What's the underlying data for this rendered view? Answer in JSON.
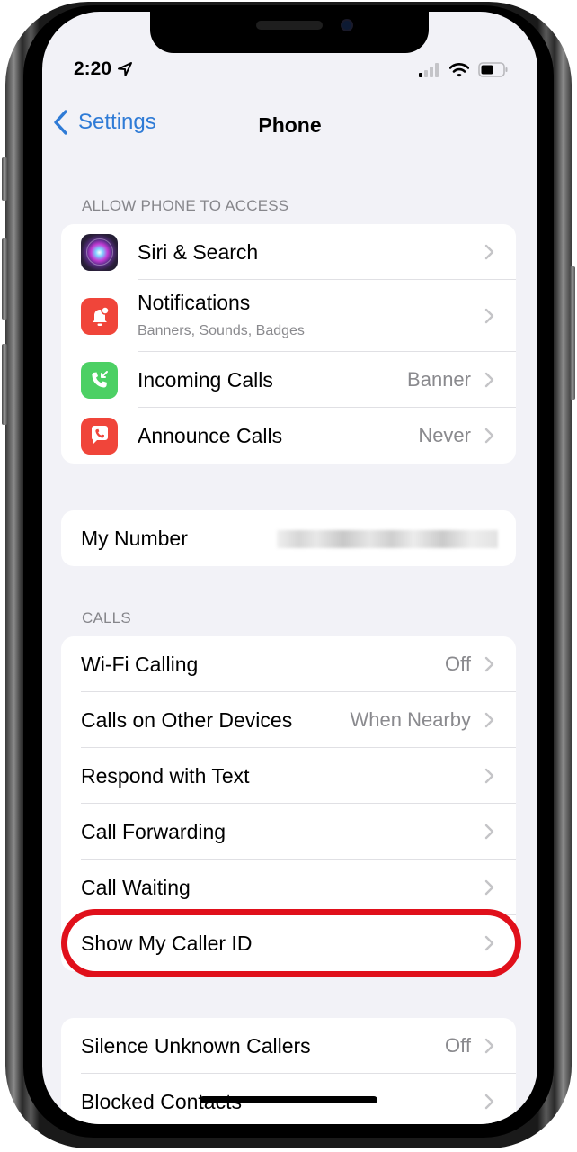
{
  "status_bar": {
    "time": "2:20",
    "location_icon": "location-arrow-icon",
    "signal_icon": "cellular-signal-icon",
    "wifi_icon": "wifi-icon",
    "battery_icon": "battery-icon"
  },
  "nav": {
    "back_label": "Settings",
    "title": "Phone"
  },
  "sections": {
    "access": {
      "header": "ALLOW PHONE TO ACCESS",
      "rows": [
        {
          "label": "Siri & Search",
          "icon": "siri-icon"
        },
        {
          "label": "Notifications",
          "subtitle": "Banners, Sounds, Badges",
          "icon": "notifications-bell-icon"
        },
        {
          "label": "Incoming Calls",
          "value": "Banner",
          "icon": "incoming-call-icon"
        },
        {
          "label": "Announce Calls",
          "value": "Never",
          "icon": "announce-calls-icon"
        }
      ]
    },
    "number": {
      "rows": [
        {
          "label": "My Number",
          "value_obscured": true
        }
      ]
    },
    "calls": {
      "header": "CALLS",
      "rows": [
        {
          "label": "Wi-Fi Calling",
          "value": "Off"
        },
        {
          "label": "Calls on Other Devices",
          "value": "When Nearby"
        },
        {
          "label": "Respond with Text"
        },
        {
          "label": "Call Forwarding"
        },
        {
          "label": "Call Waiting"
        },
        {
          "label": "Show My Caller ID",
          "highlighted": true
        }
      ]
    },
    "blocking": {
      "rows": [
        {
          "label": "Silence Unknown Callers",
          "value": "Off"
        },
        {
          "label": "Blocked Contacts"
        }
      ]
    }
  },
  "colors": {
    "accent": "#2f7bd6",
    "highlight": "#e0101b",
    "siri": "#2a1f3a",
    "notifications": "#f0453a",
    "incoming_calls": "#4cd064",
    "announce_calls": "#f0453a",
    "background": "#f2f2f7"
  }
}
